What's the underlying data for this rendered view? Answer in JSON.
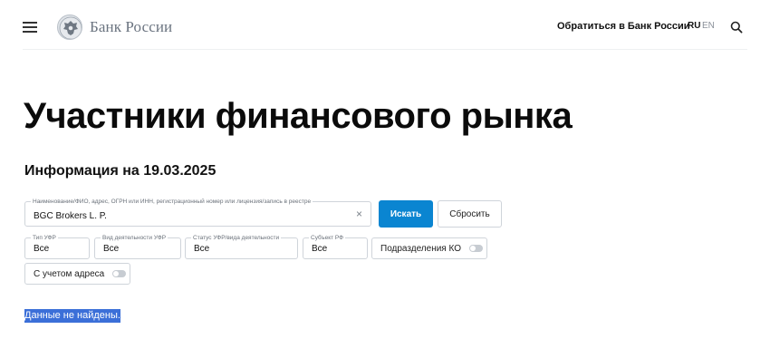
{
  "header": {
    "logo_text": "Банк России",
    "contact_link": "Обратиться в Банк России",
    "lang_ru": "RU",
    "lang_en": "EN",
    "icons": [
      "menu-icon",
      "emblem-icon",
      "search-icon"
    ]
  },
  "page": {
    "title": "Участники финансового рынка",
    "info_date": "Информация на 19.03.2025"
  },
  "search": {
    "main_legend": "Наименование/ФИО, адрес, ОГРН или ИНН, регистрационный номер или лицензия/запись в реестре",
    "main_value": "BGC Brokers L. P.",
    "clear_symbol": "×",
    "search_button": "Искать",
    "reset_button": "Сбросить"
  },
  "filters": {
    "type": {
      "legend": "Тип УФР",
      "value": "Все"
    },
    "activity": {
      "legend": "Вид деятельности УФР",
      "value": "Все"
    },
    "status": {
      "legend": "Статус УФР/вида деятельности",
      "value": "Все"
    },
    "subject": {
      "legend": "Субъект РФ",
      "value": "Все"
    },
    "subdivisions": {
      "label": "Подразделения КО",
      "checked": false
    },
    "address": {
      "label": "С учетом адреса",
      "checked": false
    }
  },
  "result": {
    "message": "Данные не найдены."
  },
  "colors": {
    "accent": "#0a85d1",
    "selection": "#3b6fd8"
  }
}
